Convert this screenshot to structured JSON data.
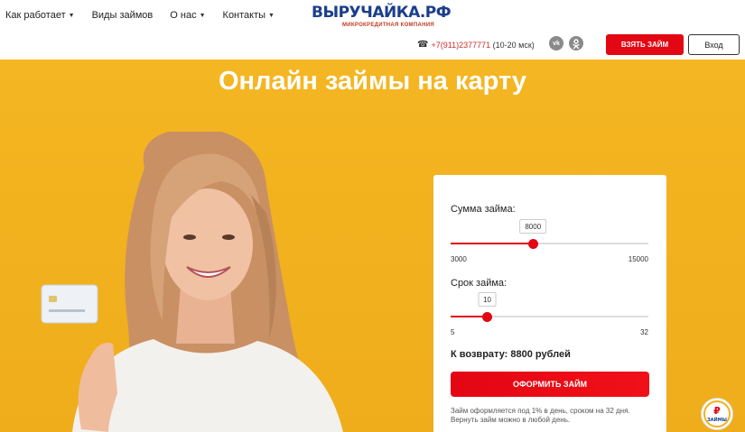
{
  "nav": [
    {
      "label": "Как работает",
      "dropdown": true
    },
    {
      "label": "Виды займов",
      "dropdown": false
    },
    {
      "label": "О нас",
      "dropdown": true
    },
    {
      "label": "Контакты",
      "dropdown": true
    }
  ],
  "logo": {
    "text": "ВЫРУЧАЙКА.РФ",
    "subtitle": "МИКРОКРЕДИТНАЯ КОМПАНИЯ"
  },
  "phone": {
    "number": "+7(911)2377771",
    "hours": "(10-20 мск)"
  },
  "social": {
    "vk": "vk",
    "ok": "ok"
  },
  "header_buttons": {
    "take_loan": "ВЗЯТЬ ЗАЙМ",
    "login": "Вход"
  },
  "hero": {
    "title": "Онлайн займы на карту"
  },
  "calculator": {
    "amount": {
      "label": "Сумма займа:",
      "value": "8000",
      "min": "3000",
      "max": "15000",
      "fraction": 0.4167
    },
    "term": {
      "label": "Срок займа:",
      "value": "10",
      "min": "5",
      "max": "32",
      "fraction": 0.1852
    },
    "total": "К возврату: 8800 рублей",
    "apply_button": "ОФОРМИТЬ ЗАЙМ",
    "note": "Займ оформляется под 1% в день, сроком на 32 дня. Вернуть займ можно в любой день."
  },
  "badge": {
    "label": "ЗАЙМЫ"
  },
  "colors": {
    "accent": "#e30613",
    "hero_bg": "#f2b21e",
    "brand_blue": "#1b3e8c"
  }
}
